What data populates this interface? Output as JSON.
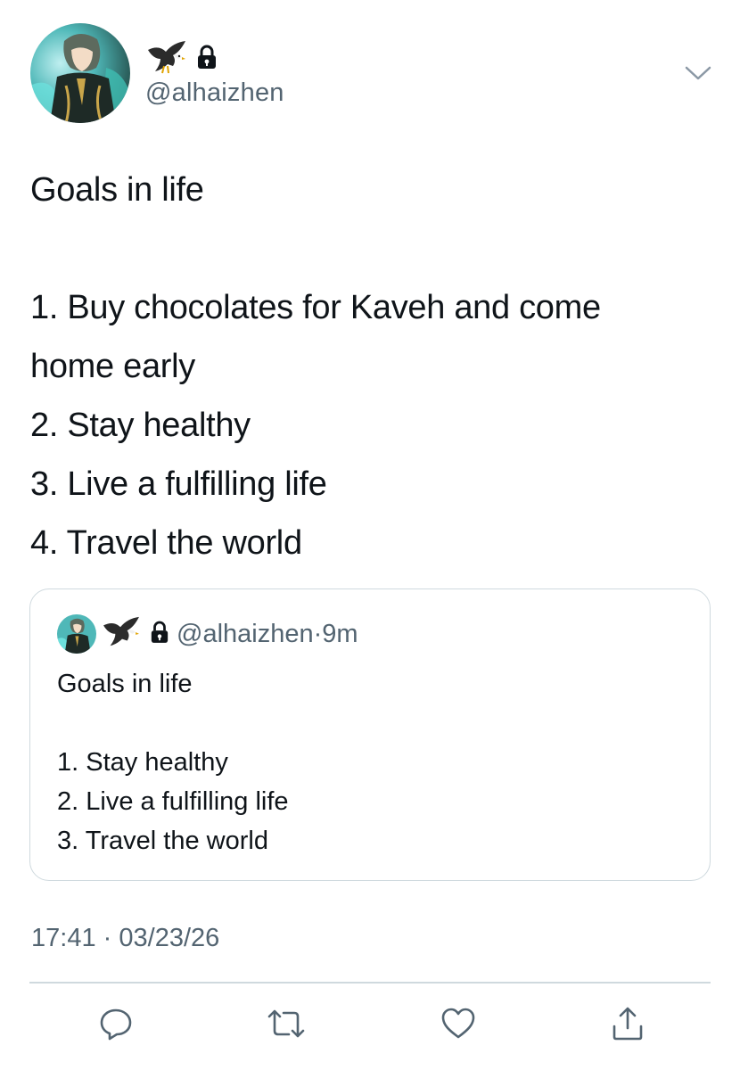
{
  "author": {
    "handle": "@alhaizhen",
    "badges": [
      "eagle-emoji",
      "lock-icon"
    ]
  },
  "tweet": {
    "title": "Goals in life",
    "items": [
      "1. Buy chocolates for Kaveh and come",
      "home early",
      "2. Stay healthy",
      "3. Live a fulfilling life",
      "4. Travel the world"
    ]
  },
  "quoted_tweet": {
    "handle": "@alhaizhen",
    "time": "9m",
    "separator": "·",
    "title": "Goals in life",
    "items": [
      "1. Stay healthy",
      "2. Live a fulfilling life",
      "3. Travel the world"
    ]
  },
  "meta": {
    "time": "17:41",
    "separator": "·",
    "date": "03/23/26"
  },
  "actions": [
    "reply-icon",
    "retweet-icon",
    "like-icon",
    "share-icon"
  ],
  "colors": {
    "text": "#0f1419",
    "secondary": "#536471",
    "border": "#cfd9de"
  }
}
